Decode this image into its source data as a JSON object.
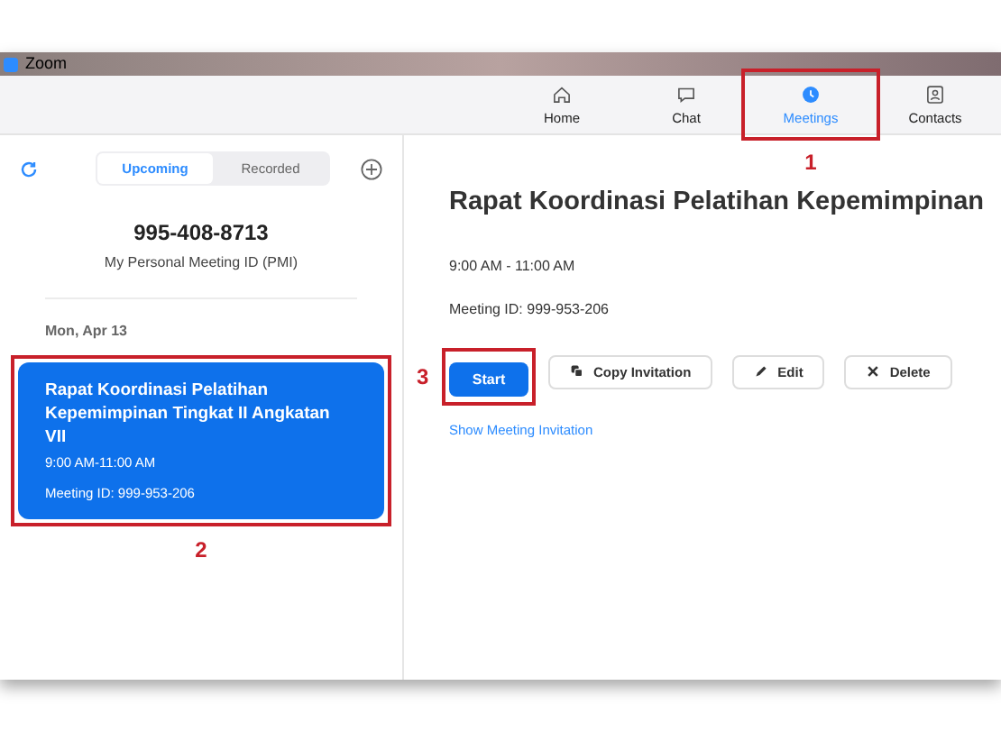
{
  "window": {
    "title": "Zoom"
  },
  "nav": [
    {
      "label": "Home",
      "kind": "home",
      "selected": false
    },
    {
      "label": "Chat",
      "kind": "chat",
      "selected": false
    },
    {
      "label": "Meetings",
      "kind": "clock",
      "selected": true,
      "annotation": "1"
    },
    {
      "label": "Contacts",
      "kind": "contact",
      "selected": false
    }
  ],
  "sidebar": {
    "tabs": [
      {
        "label": "Upcoming",
        "selected": true
      },
      {
        "label": "Recorded",
        "selected": false
      }
    ],
    "pmi": {
      "number": "995-408-8713",
      "caption": "My Personal Meeting ID (PMI)"
    },
    "date": "Mon, Apr 13",
    "meetings": [
      {
        "title": "Rapat Koordinasi Pelatihan Kepemimpinan Tingkat II Angkatan VII",
        "time": "9:00 AM-11:00 AM",
        "meeting_id": "Meeting ID: 999-953-206",
        "selected": true,
        "annotation": "2"
      }
    ]
  },
  "detail": {
    "title": "Rapat Koordinasi Pelatihan Kepemimpinan",
    "time": "9:00 AM - 11:00 AM",
    "meeting_id": "Meeting ID: 999-953-206",
    "buttons": [
      {
        "label": "Start",
        "kind": "primary",
        "annotation": "3"
      },
      {
        "label": "Copy Invitation",
        "kind": "copy"
      },
      {
        "label": "Edit",
        "kind": "edit"
      },
      {
        "label": "Delete",
        "kind": "delete"
      }
    ],
    "link": "Show Meeting Invitation"
  }
}
